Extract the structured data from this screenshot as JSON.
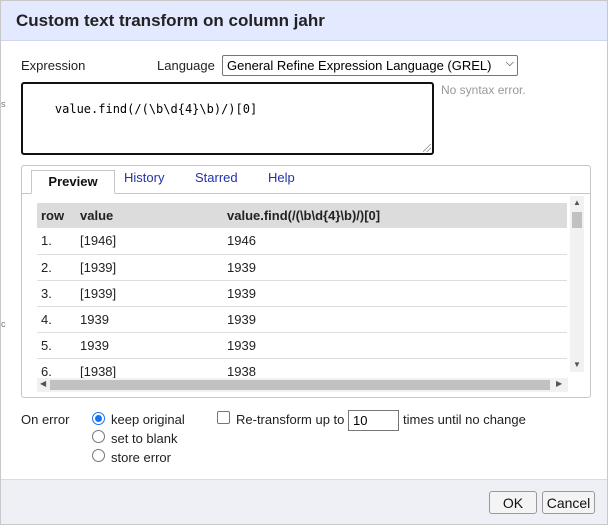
{
  "dialog": {
    "title": "Custom text transform on column jahr"
  },
  "expression": {
    "label": "Expression",
    "language_label": "Language",
    "language_selected": "General Refine Expression Language (GREL)",
    "code": "value.find(/(\\b\\d{4}\\b)/)[0]",
    "syntax_status": "No syntax error."
  },
  "tabs": [
    {
      "label": "Preview",
      "active": true
    },
    {
      "label": "History"
    },
    {
      "label": "Starred"
    },
    {
      "label": "Help"
    }
  ],
  "preview": {
    "columns": [
      "row",
      "value",
      "value.find(/(\\b\\d{4}\\b)/)[0]"
    ],
    "rows": [
      {
        "row": "1.",
        "value": "[1946]",
        "result": "1946"
      },
      {
        "row": "2.",
        "value": "[1939]",
        "result": "1939"
      },
      {
        "row": "3.",
        "value": "[1939]",
        "result": "1939"
      },
      {
        "row": "4.",
        "value": "1939",
        "result": "1939"
      },
      {
        "row": "5.",
        "value": "1939",
        "result": "1939"
      },
      {
        "row": "6.",
        "value": "[1938]",
        "result": "1938"
      }
    ]
  },
  "on_error": {
    "label": "On error",
    "options": [
      {
        "label": "keep original",
        "checked": true
      },
      {
        "label": "set to blank",
        "checked": false
      },
      {
        "label": "store error",
        "checked": false
      }
    ]
  },
  "retransform": {
    "label": "Re-transform up to",
    "value": "10",
    "suffix": "times until no change",
    "checked": false
  },
  "buttons": {
    "ok": "OK",
    "cancel": "Cancel"
  },
  "colors": {
    "title_bar": "#e3e9ff",
    "tab_link": "#2233aa",
    "radio_accent": "#1a73e8"
  }
}
